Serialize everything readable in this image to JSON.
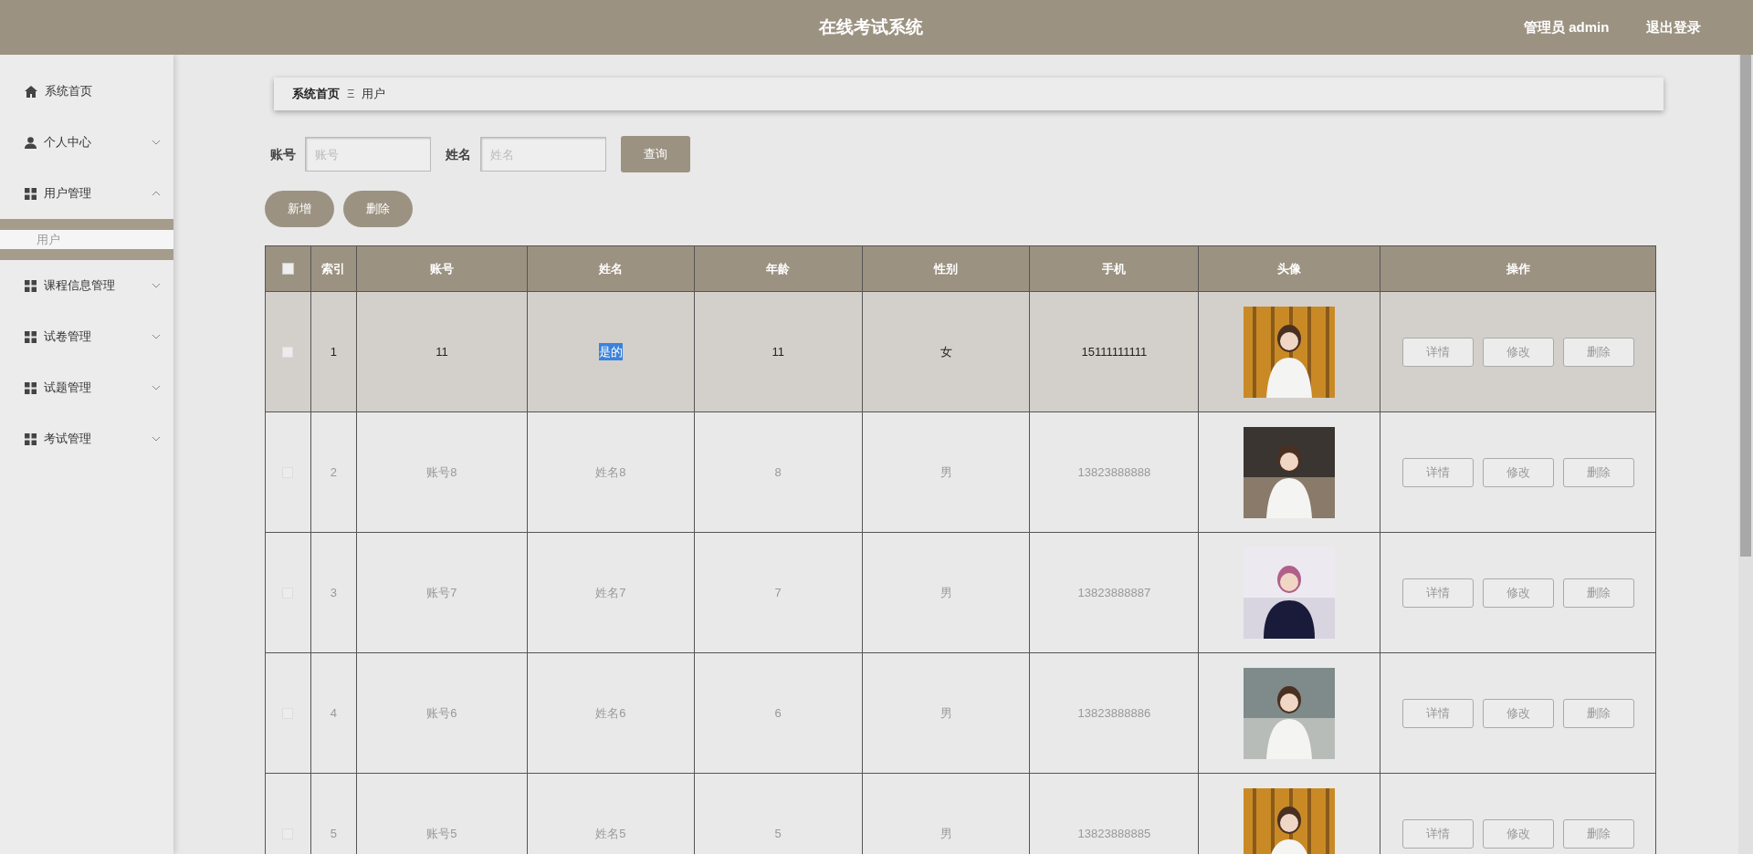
{
  "header": {
    "title": "在线考试系统",
    "user": "管理员 admin",
    "logout": "退出登录"
  },
  "sidebar": {
    "items": [
      {
        "label": "系统首页",
        "kind": "home"
      },
      {
        "label": "个人中心",
        "kind": "user",
        "expanded": false
      },
      {
        "label": "用户管理",
        "kind": "group",
        "expanded": true,
        "children": [
          {
            "label": "用户",
            "selected": true
          }
        ]
      },
      {
        "label": "课程信息管理",
        "kind": "group",
        "expanded": false
      },
      {
        "label": "试卷管理",
        "kind": "group",
        "expanded": false
      },
      {
        "label": "试题管理",
        "kind": "group",
        "expanded": false
      },
      {
        "label": "考试管理",
        "kind": "group",
        "expanded": false
      }
    ]
  },
  "breadcrumb": {
    "items": [
      "系统首页",
      "用户"
    ],
    "separator": "Ξ"
  },
  "search": {
    "fields": [
      {
        "label": "账号",
        "placeholder": "账号"
      },
      {
        "label": "姓名",
        "placeholder": "姓名"
      }
    ],
    "button": "查询"
  },
  "actions": [
    "新增",
    "删除"
  ],
  "table": {
    "header_checked": false,
    "columns": [
      "索引",
      "账号",
      "姓名",
      "年龄",
      "性别",
      "手机",
      "头像",
      "操作"
    ],
    "rows": [
      {
        "selected": true,
        "checked": false,
        "name_highlighted": true,
        "cells": [
          "1",
          "11",
          "是的",
          "11",
          "女",
          "15111111111"
        ],
        "buttons": [
          "详情",
          "修改",
          "删除"
        ]
      },
      {
        "selected": false,
        "checked": false,
        "name_highlighted": false,
        "cells": [
          "2",
          "账号8",
          "姓名8",
          "8",
          "男",
          "13823888888"
        ],
        "buttons": [
          "详情",
          "修改",
          "删除"
        ]
      },
      {
        "selected": false,
        "checked": false,
        "name_highlighted": false,
        "cells": [
          "3",
          "账号7",
          "姓名7",
          "7",
          "男",
          "13823888887"
        ],
        "buttons": [
          "详情",
          "修改",
          "删除"
        ]
      },
      {
        "selected": false,
        "checked": false,
        "name_highlighted": false,
        "cells": [
          "4",
          "账号6",
          "姓名6",
          "6",
          "男",
          "13823888886"
        ],
        "buttons": [
          "详情",
          "修改",
          "删除"
        ]
      },
      {
        "selected": false,
        "checked": false,
        "name_highlighted": false,
        "cells": [
          "5",
          "账号5",
          "姓名5",
          "5",
          "男",
          "13823888885"
        ],
        "buttons": [
          "详情",
          "修改",
          "删除"
        ]
      }
    ]
  }
}
